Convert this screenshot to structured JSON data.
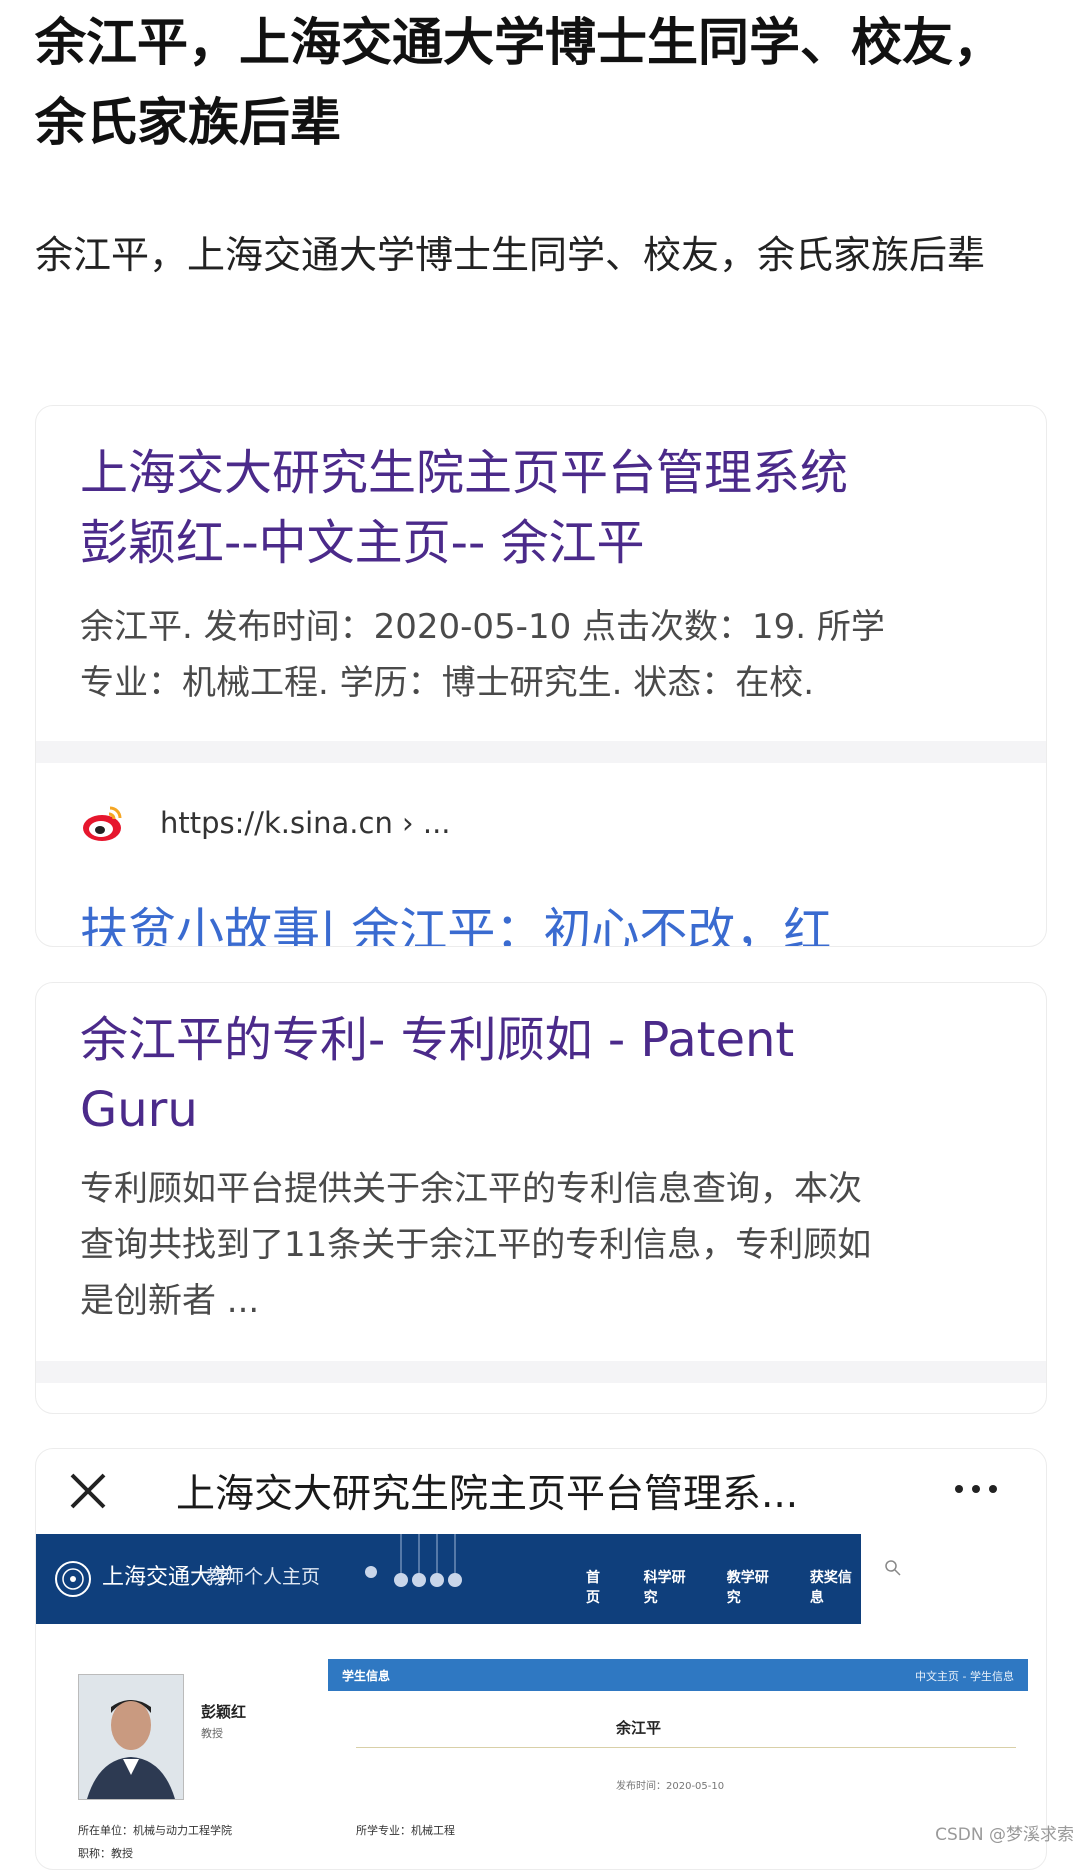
{
  "article": {
    "title": "余江平，上海交通大学博士生同学、校友，余氏家族后辈",
    "subtitle": "余江平，上海交通大学博士生同学、校友，余氏家族后辈"
  },
  "results": [
    {
      "title_line1": "上海交大研究生院主页平台管理系统",
      "title_line2": "彭颖红--中文主页-- 余江平",
      "snippet_line1": "余江平. 发布时间：2020-05-10 点击次数：19. 所学",
      "snippet_line2": "专业：机械工程. 学历：博士研究生. 状态：在校.",
      "source_icon": "weibo-icon",
      "source_url": "https://k.sina.cn › ...",
      "clipped_next_title": "扶贫小故事| 余江平：初心不改，红"
    },
    {
      "title_line1": "余江平的专利- 专利顾如 - Patent",
      "title_line2": "Guru",
      "snippet_line1": "专利顾如平台提供关于余江平的专利信息查询，本次",
      "snippet_line2": "查询共找到了11条关于余江平的专利信息，专利顾如",
      "snippet_line3": "是创新者 ..."
    }
  ],
  "screenshot_card": {
    "header_title": "上海交大研究生院主页平台管理系...",
    "close_icon": "close-icon",
    "more_icon": "more-icon",
    "site": {
      "uni_name": "上海交通大学",
      "uni_sub": "教师个人主页",
      "nav": [
        "首页",
        "科学研究",
        "教学研究",
        "获奖信息"
      ],
      "professor_name": "彭颖红",
      "professor_title": "教授",
      "unit": "所在单位：机械与动力工程学院",
      "rank": "职称：教授",
      "info_bar_label": "学生信息",
      "info_bar_crumb": "中文主页 - 学生信息",
      "student_name": "余江平",
      "publish_date": "发布时间：2020-05-10",
      "major": "所学专业：机械工程"
    }
  },
  "watermark": "CSDN @梦溪求索",
  "colors": {
    "result_title": "#4b2a8a",
    "link_blue": "#3a6bd0",
    "uni_blue": "#0f3f7c",
    "info_blue": "#2f78c2"
  }
}
